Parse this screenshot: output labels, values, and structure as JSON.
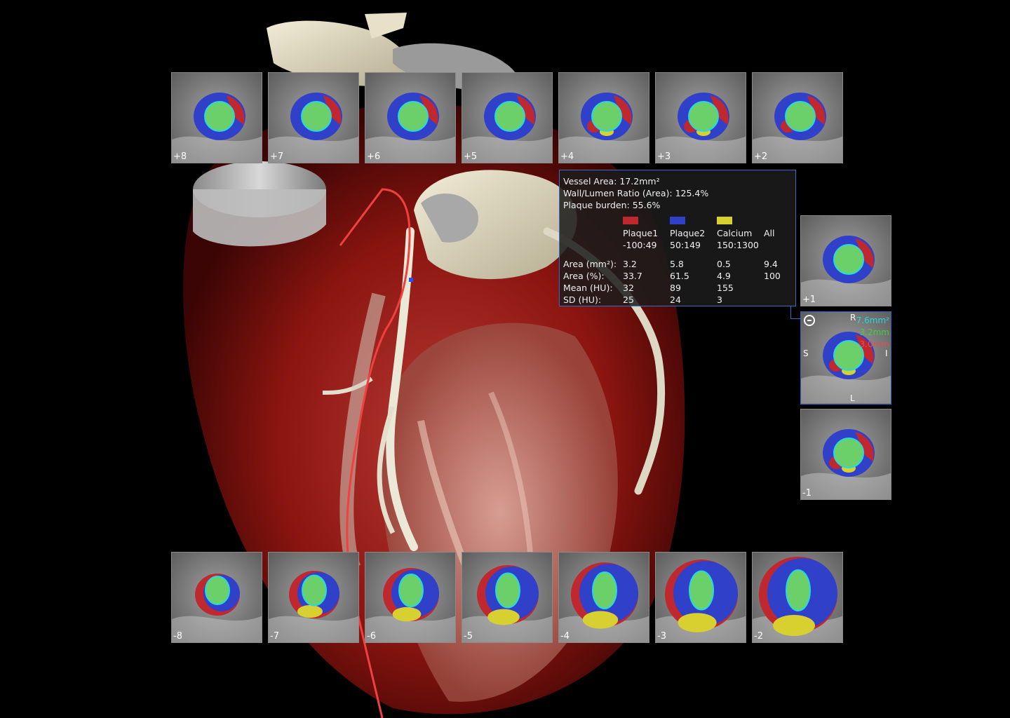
{
  "colors": {
    "plaque1": "#c0282f",
    "plaque2": "#3040c8",
    "calcium": "#d8d030",
    "lumen": "#6cd06a",
    "contour": "#28d8e0",
    "panel_border": "#3a6bc6"
  },
  "top_slices": [
    "+8",
    "+7",
    "+6",
    "+5",
    "+4",
    "+3",
    "+2"
  ],
  "bottom_slices": [
    "-8",
    "-7",
    "-6",
    "-5",
    "-4",
    "-3",
    "-2"
  ],
  "side_slices": {
    "upper": "+1",
    "lower": "-1"
  },
  "detail": {
    "icon": "minus-circle-icon",
    "orient_top": "R",
    "orient_left": "S",
    "orient_right": "I",
    "orient_bottom": "L",
    "meas_cyan": "7.6mm²",
    "meas_green": "3.2mm",
    "meas_red": "3.0mm"
  },
  "info": {
    "vessel_area": "Vessel Area: 17.2mm²",
    "wall_lumen": "Wall/Lumen Ratio (Area): 125.4%",
    "plaque_burden": "Plaque burden: 55.6%",
    "legend": [
      {
        "name": "Plaque1",
        "range": "-100:49"
      },
      {
        "name": "Plaque2",
        "range": "50:149"
      },
      {
        "name": "Calcium",
        "range": "150:1300"
      },
      {
        "name": "All",
        "range": ""
      }
    ],
    "rows": [
      {
        "label": "Area (mm²):",
        "values": [
          "3.2",
          "5.8",
          "0.5",
          "9.4"
        ]
      },
      {
        "label": "Area (%):",
        "values": [
          "33.7",
          "61.5",
          "4.9",
          "100"
        ]
      },
      {
        "label": "Mean (HU):",
        "values": [
          "32",
          "89",
          "155",
          ""
        ]
      },
      {
        "label": "SD (HU):",
        "values": [
          "25",
          "24",
          "3",
          ""
        ]
      }
    ]
  }
}
